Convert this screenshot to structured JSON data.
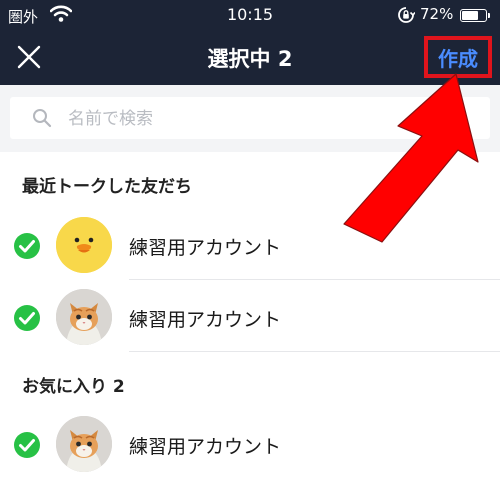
{
  "status_bar": {
    "carrier": "圏外",
    "time": "10:15",
    "battery_percent": "72%",
    "battery_level": 0.72,
    "icons": [
      "wifi-icon",
      "rotation-lock-icon",
      "battery-icon"
    ]
  },
  "nav": {
    "title": "選択中 2",
    "create_label": "作成",
    "close_icon": "close-icon",
    "create_highlight_color": "#e0141c",
    "create_text_color": "#4a8cff",
    "background": "#1c2436"
  },
  "search": {
    "placeholder": "名前で検索",
    "value": ""
  },
  "sections": [
    {
      "title": "最近トークした友だち",
      "items": [
        {
          "name": "練習用アカウント",
          "avatar": "sally-duck-avatar",
          "selected": true
        },
        {
          "name": "練習用アカウント",
          "avatar": "kitten-photo-avatar",
          "selected": true
        }
      ]
    },
    {
      "title": "お気に入り 2",
      "items": [
        {
          "name": "練習用アカウント",
          "avatar": "kitten-photo-avatar",
          "selected": true
        }
      ]
    }
  ],
  "annotation": {
    "arrow_color": "#ff0000",
    "points_to": "create-button"
  },
  "colors": {
    "check_green": "#27c145",
    "section_background": "#f3f4f6"
  }
}
